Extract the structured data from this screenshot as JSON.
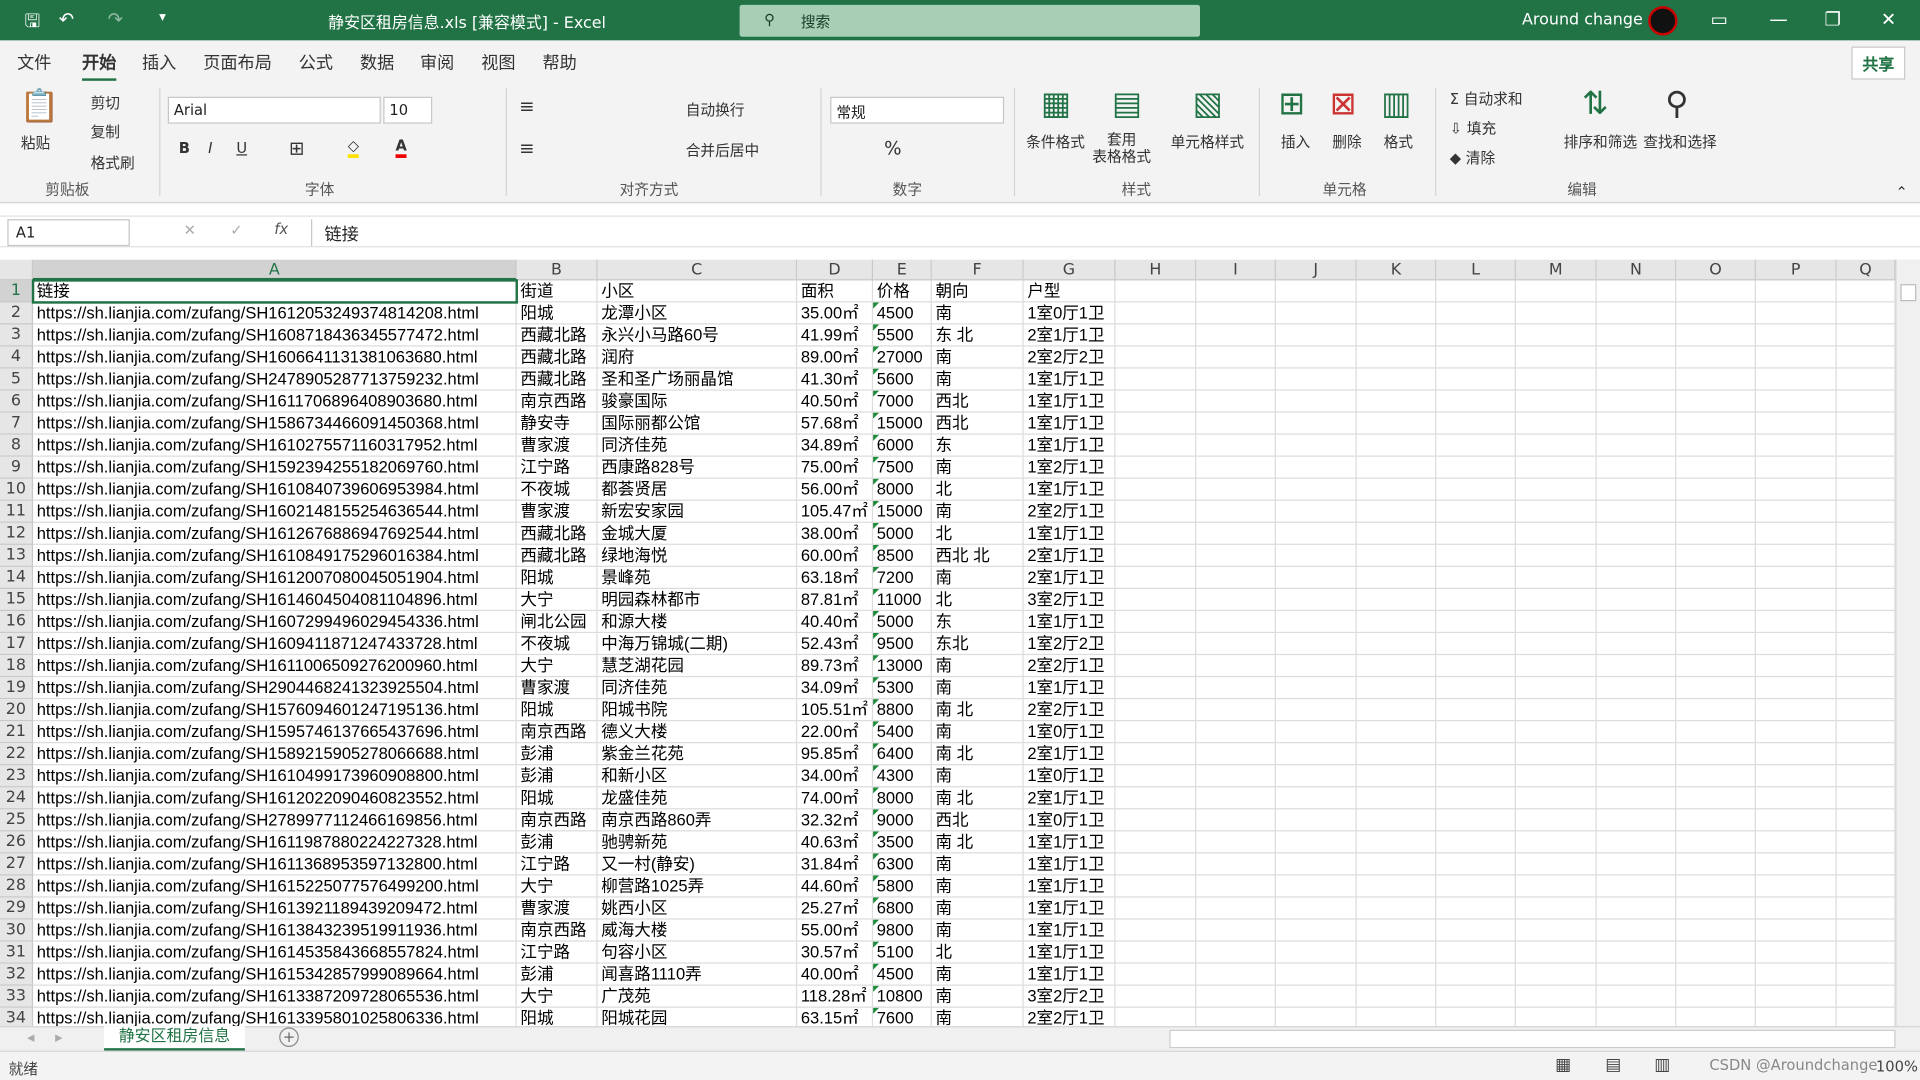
{
  "titlebar": {
    "title": "静安区租房信息.xls  [兼容模式]  -  Excel",
    "search_placeholder": "搜索",
    "user": "Around change",
    "save_icon": "save-icon",
    "undo_icon": "undo-icon",
    "redo_icon": "redo-icon"
  },
  "menu": {
    "tabs": [
      "文件",
      "开始",
      "插入",
      "页面布局",
      "公式",
      "数据",
      "审阅",
      "视图",
      "帮助"
    ],
    "active": 1,
    "share": "共享"
  },
  "ribbon": {
    "clipboard": {
      "paste": "粘贴",
      "cut": "剪切",
      "copy": "复制",
      "format_painter": "格式刷",
      "label": "剪贴板"
    },
    "font": {
      "name": "Arial",
      "size": "10",
      "label": "字体",
      "bold": "B",
      "italic": "I",
      "underline": "U"
    },
    "align": {
      "wrap": "自动换行",
      "merge": "合并后居中",
      "label": "对齐方式"
    },
    "number": {
      "format": "常规",
      "label": "数字"
    },
    "styles": {
      "cond": "条件格式",
      "table": "套用\n表格格式",
      "cell": "单元格样式",
      "label": "样式"
    },
    "cells": {
      "insert": "插入",
      "delete": "删除",
      "format": "格式",
      "label": "单元格"
    },
    "edit": {
      "autosum": "自动求和",
      "fill": "填充",
      "clear": "清除",
      "sort": "排序和筛选",
      "find": "查找和选择",
      "label": "编辑"
    }
  },
  "formula": {
    "namebox": "A1",
    "content": "链接",
    "fx": "fx"
  },
  "columns": [
    "A",
    "B",
    "C",
    "D",
    "E",
    "F",
    "G",
    "H",
    "I",
    "J",
    "K",
    "L",
    "M",
    "N",
    "O",
    "P",
    "Q"
  ],
  "header_row": [
    "链接",
    "街道",
    "小区",
    "面积",
    "价格",
    "朝向",
    "户型"
  ],
  "url_prefix": "https://sh.lianjia.com/zufang/",
  "rows": [
    [
      "SH1612053249374814208.html",
      "阳城",
      "龙潭小区",
      "35.00㎡",
      "4500",
      "南",
      "1室0厅1卫"
    ],
    [
      "SH1608718436345577472.html",
      "西藏北路",
      "永兴小马路60号",
      "41.99㎡",
      "5500",
      "东 北",
      "2室1厅1卫"
    ],
    [
      "SH1606641131381063680.html",
      "西藏北路",
      "润府",
      "89.00㎡",
      "27000",
      "南",
      "2室2厅2卫"
    ],
    [
      "SH2478905287713759232.html",
      "西藏北路",
      "圣和圣广场丽晶馆",
      "41.30㎡",
      "5600",
      "南",
      "1室1厅1卫"
    ],
    [
      "SH1611706896408903680.html",
      "南京西路",
      "骏豪国际",
      "40.50㎡",
      "7000",
      "西北",
      "1室1厅1卫"
    ],
    [
      "SH1586734466091450368.html",
      "静安寺",
      "国际丽都公馆",
      "57.68㎡",
      "15000",
      "西北",
      "1室1厅1卫"
    ],
    [
      "SH1610275571160317952.html",
      "曹家渡",
      "同济佳苑",
      "34.89㎡",
      "6000",
      "东",
      "1室1厅1卫"
    ],
    [
      "SH1592394255182069760.html",
      "江宁路",
      "西康路828号",
      "75.00㎡",
      "7500",
      "南",
      "1室2厅1卫"
    ],
    [
      "SH1610840739606953984.html",
      "不夜城",
      "都荟贤居",
      "56.00㎡",
      "8000",
      "北",
      "1室1厅1卫"
    ],
    [
      "SH1602148155254636544.html",
      "曹家渡",
      "新宏安家园",
      "105.47㎡",
      "15000",
      "南",
      "2室2厅1卫"
    ],
    [
      "SH1612676886947692544.html",
      "西藏北路",
      "金城大厦",
      "38.00㎡",
      "5000",
      "北",
      "1室1厅1卫"
    ],
    [
      "SH1610849175296016384.html",
      "西藏北路",
      "绿地海悦",
      "60.00㎡",
      "8500",
      "西北 北",
      "2室1厅1卫"
    ],
    [
      "SH1612007080045051904.html",
      "阳城",
      "景峰苑",
      "63.18㎡",
      "7200",
      "南",
      "2室1厅1卫"
    ],
    [
      "SH1614604504081104896.html",
      "大宁",
      "明园森林都市",
      "87.81㎡",
      "11000",
      "北",
      "3室2厅1卫"
    ],
    [
      "SH1607299496029454336.html",
      "闸北公园",
      "和源大楼",
      "40.40㎡",
      "5000",
      "东",
      "1室1厅1卫"
    ],
    [
      "SH1609411871247433728.html",
      "不夜城",
      "中海万锦城(二期)",
      "52.43㎡",
      "9500",
      "东北",
      "1室2厅2卫"
    ],
    [
      "SH1611006509276200960.html",
      "大宁",
      "慧芝湖花园",
      "89.73㎡",
      "13000",
      "南",
      "2室2厅1卫"
    ],
    [
      "SH2904468241323925504.html",
      "曹家渡",
      "同济佳苑",
      "34.09㎡",
      "5300",
      "南",
      "1室1厅1卫"
    ],
    [
      "SH1576094601247195136.html",
      "阳城",
      "阳城书院",
      "105.51㎡",
      "8800",
      "南 北",
      "2室2厅1卫"
    ],
    [
      "SH1595746137665437696.html",
      "南京西路",
      "德义大楼",
      "22.00㎡",
      "5400",
      "南",
      "1室0厅1卫"
    ],
    [
      "SH1589215905278066688.html",
      "彭浦",
      "紫金兰花苑",
      "95.85㎡",
      "6400",
      "南 北",
      "2室1厅1卫"
    ],
    [
      "SH1610499173960908800.html",
      "彭浦",
      "和新小区",
      "34.00㎡",
      "4300",
      "南",
      "1室0厅1卫"
    ],
    [
      "SH1612022090460823552.html",
      "阳城",
      "龙盛佳苑",
      "74.00㎡",
      "8000",
      "南 北",
      "2室1厅1卫"
    ],
    [
      "SH2789977112466169856.html",
      "南京西路",
      "南京西路860弄",
      "32.32㎡",
      "9000",
      "西北",
      "1室0厅1卫"
    ],
    [
      "SH1611987880224227328.html",
      "彭浦",
      "驰骋新苑",
      "40.63㎡",
      "3500",
      "南 北",
      "1室1厅1卫"
    ],
    [
      "SH1611368953597132800.html",
      "江宁路",
      "又一村(静安)",
      "31.84㎡",
      "6300",
      "南",
      "1室1厅1卫"
    ],
    [
      "SH1615225077576499200.html",
      "大宁",
      "柳营路1025弄",
      "44.60㎡",
      "5800",
      "南",
      "1室1厅1卫"
    ],
    [
      "SH1613921189439209472.html",
      "曹家渡",
      "姚西小区",
      "25.27㎡",
      "6800",
      "南",
      "1室1厅1卫"
    ],
    [
      "SH1613843239519911936.html",
      "南京西路",
      "威海大楼",
      "55.00㎡",
      "9800",
      "南",
      "1室1厅1卫"
    ],
    [
      "SH1614535843668557824.html",
      "江宁路",
      "句容小区",
      "30.57㎡",
      "5100",
      "北",
      "1室1厅1卫"
    ],
    [
      "SH1615342857999089664.html",
      "彭浦",
      "闻喜路1110弄",
      "40.00㎡",
      "4500",
      "南",
      "1室1厅1卫"
    ],
    [
      "SH1613387209728065536.html",
      "大宁",
      "广茂苑",
      "118.28㎡",
      "10800",
      "南",
      "3室2厅2卫"
    ],
    [
      "SH1613395801025806336.html",
      "阳城",
      "阳城花园",
      "63.15㎡",
      "7600",
      "南",
      "2室2厅1卫"
    ]
  ],
  "sheet": {
    "tab": "静安区租房信息",
    "add": "+"
  },
  "status": {
    "ready": "就绪",
    "zoom": "100%",
    "watermark": "CSDN @Aroundchange"
  },
  "colors": {
    "accent": "#217346"
  }
}
